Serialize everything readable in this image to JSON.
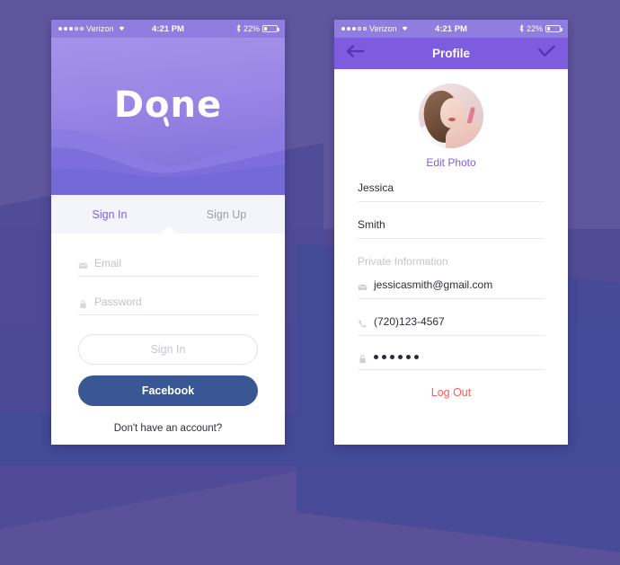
{
  "background": {
    "base_color": "#5a5199",
    "band_color": "#454a96"
  },
  "status_bar": {
    "carrier": "Verizon",
    "time": "4:21 PM",
    "battery_percent": "22%",
    "signal_dots_filled": 3,
    "signal_dots_empty": 2,
    "wifi_icon": "wifi-icon",
    "bluetooth_icon": "bluetooth-icon",
    "battery_icon": "battery-icon"
  },
  "signin_screen": {
    "logo": {
      "part1": "D",
      "part2": "o",
      "part3": "ne",
      "full": "Done"
    },
    "tabs": [
      {
        "label": "Sign In",
        "active": true
      },
      {
        "label": "Sign Up",
        "active": false
      }
    ],
    "fields": [
      {
        "placeholder": "Email",
        "icon": "envelope-icon",
        "value": ""
      },
      {
        "placeholder": "Password",
        "icon": "lock-icon",
        "value": ""
      }
    ],
    "buttons": {
      "signin_label": "Sign In",
      "facebook_label": "Facebook",
      "facebook_color": "#3a5795"
    },
    "footer_link": "Don't have an account?",
    "accent_color": "#7e5fe0"
  },
  "profile_screen": {
    "navbar": {
      "title": "Profile",
      "back_icon": "back-arrow-icon",
      "confirm_icon": "checkmark-icon",
      "background_color": "#7e5ce0"
    },
    "avatar": {
      "alt": "user-profile-photo",
      "edit_label": "Edit Photo"
    },
    "rows": [
      {
        "value": "Jessica",
        "icon": null,
        "type": "text"
      },
      {
        "value": "Smith",
        "icon": null,
        "type": "text"
      },
      {
        "value": "Private Information",
        "icon": null,
        "type": "section-header"
      },
      {
        "value": "jessicasmith@gmail.com",
        "icon": "envelope-icon",
        "type": "email"
      },
      {
        "value": "(720)123-4567",
        "icon": "phone-icon",
        "type": "phone"
      },
      {
        "value": "••••••",
        "icon": "lock-icon",
        "type": "password",
        "dots": 6
      }
    ],
    "logout_label": "Log Out",
    "logout_color": "#f4615e"
  }
}
